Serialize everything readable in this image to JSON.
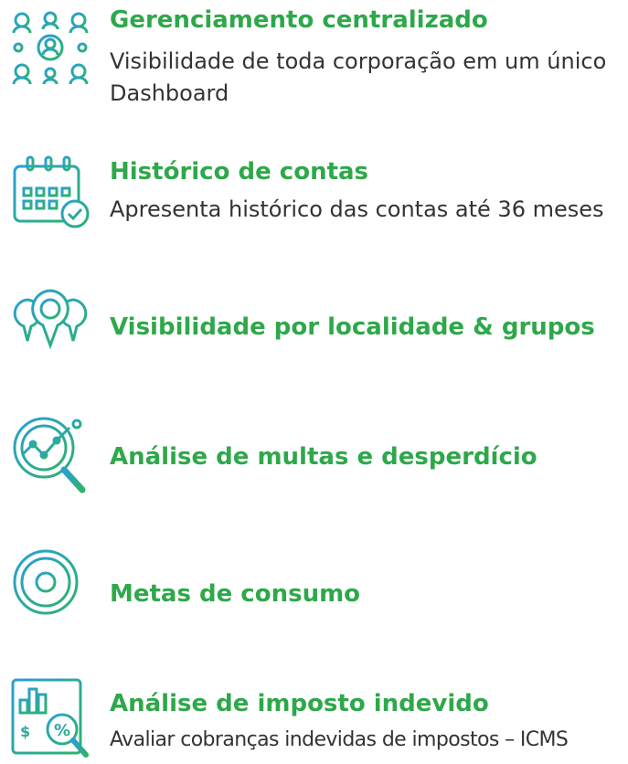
{
  "colors": {
    "accent": "#2ea84a",
    "icon_gradient_start": "#2a9fd6",
    "icon_gradient_end": "#2db36a",
    "text": "#333333"
  },
  "features": [
    {
      "icon": "network-people-icon",
      "title": "Gerenciamento centralizado",
      "description": "Visibilidade de toda corporação em um único Dashboard"
    },
    {
      "icon": "calendar-check-icon",
      "title": "Histórico de contas",
      "description": "Apresenta histórico das contas até 36 meses"
    },
    {
      "icon": "location-pins-icon",
      "title": "Visibilidade por localidade & grupos",
      "description": ""
    },
    {
      "icon": "magnifier-chart-icon",
      "title": "Análise de multas e desperdício",
      "description": ""
    },
    {
      "icon": "target-icon",
      "title": "Metas de consumo",
      "description": ""
    },
    {
      "icon": "tax-report-icon",
      "title": "Análise de imposto indevido",
      "description": "Avaliar cobranças indevidas de impostos – ICMS"
    }
  ]
}
